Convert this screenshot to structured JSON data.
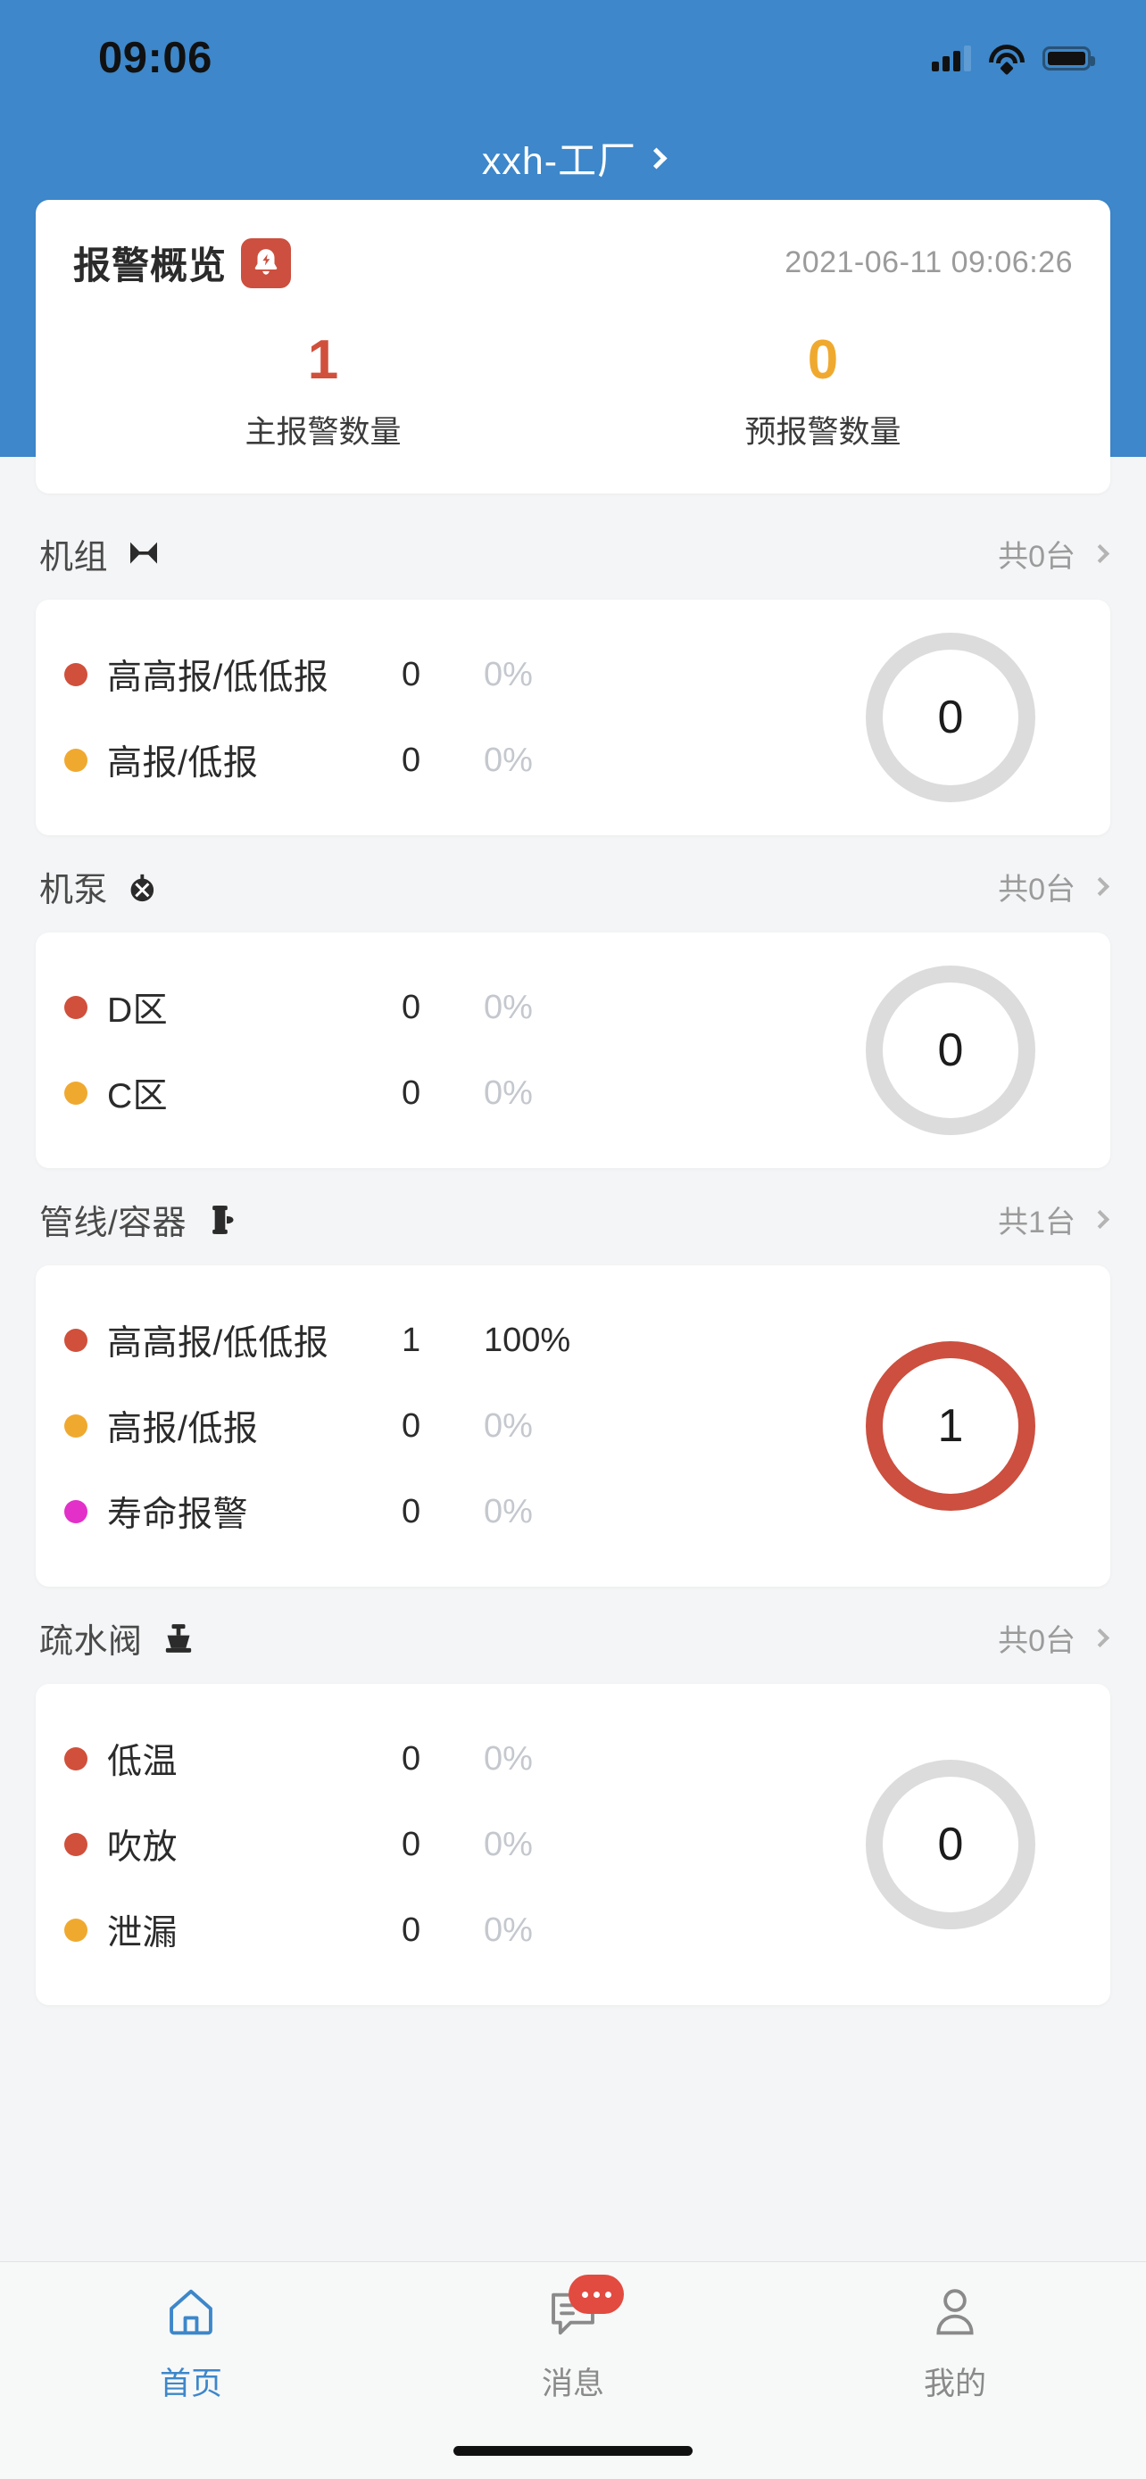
{
  "statusbar": {
    "time": "09:06",
    "cellular_icon": "cellular-signal-icon",
    "wifi_icon": "wifi-icon",
    "battery_icon": "battery-full-icon"
  },
  "header": {
    "title": "xxh-工厂",
    "chevron_icon": "chevron-right-icon",
    "background_color": "#3D87CA"
  },
  "overview": {
    "title": "报警概览",
    "badge_icon": "alarm-bell-icon",
    "badge_color": "#CC4F3F",
    "timestamp": "2021-06-11 09:06:26",
    "stats": [
      {
        "value": "1",
        "label": "主报警数量",
        "color": "#D0503C"
      },
      {
        "value": "0",
        "label": "预报警数量",
        "color": "#F0A92F"
      }
    ]
  },
  "sections": [
    {
      "name": "机组",
      "icon": "turbine-icon",
      "count_text": "共0台",
      "chevron_icon": "chevron-right-icon",
      "total": "0",
      "ring_color": "#DCDCDC",
      "rows": [
        {
          "label": "高高报/低低报",
          "value": "0",
          "percent": "0%",
          "dot_color": "#D0503C",
          "dot_class": "red",
          "pct_active": false
        },
        {
          "label": "高报/低报",
          "value": "0",
          "percent": "0%",
          "dot_color": "#F0A92F",
          "dot_class": "orange",
          "pct_active": false
        }
      ]
    },
    {
      "name": "机泵",
      "icon": "pump-icon",
      "count_text": "共0台",
      "chevron_icon": "chevron-right-icon",
      "total": "0",
      "ring_color": "#DCDCDC",
      "rows": [
        {
          "label": "D区",
          "value": "0",
          "percent": "0%",
          "dot_color": "#D0503C",
          "dot_class": "red",
          "pct_active": false
        },
        {
          "label": "C区",
          "value": "0",
          "percent": "0%",
          "dot_color": "#F0A92F",
          "dot_class": "orange",
          "pct_active": false
        }
      ]
    },
    {
      "name": "管线/容器",
      "icon": "pipeline-valve-icon",
      "count_text": "共1台",
      "chevron_icon": "chevron-right-icon",
      "total": "1",
      "ring_color": "#CC4F3F",
      "rows": [
        {
          "label": "高高报/低低报",
          "value": "1",
          "percent": "100%",
          "dot_color": "#D0503C",
          "dot_class": "red",
          "pct_active": true
        },
        {
          "label": "高报/低报",
          "value": "0",
          "percent": "0%",
          "dot_color": "#F0A92F",
          "dot_class": "orange",
          "pct_active": false
        },
        {
          "label": "寿命报警",
          "value": "0",
          "percent": "0%",
          "dot_color": "#E330C9",
          "dot_class": "magenta",
          "pct_active": false
        }
      ]
    },
    {
      "name": "疏水阀",
      "icon": "steam-trap-valve-icon",
      "count_text": "共0台",
      "chevron_icon": "chevron-right-icon",
      "total": "0",
      "ring_color": "#DCDCDC",
      "rows": [
        {
          "label": "低温",
          "value": "0",
          "percent": "0%",
          "dot_color": "#D0503C",
          "dot_class": "red",
          "pct_active": false
        },
        {
          "label": "吹放",
          "value": "0",
          "percent": "0%",
          "dot_color": "#D0503C",
          "dot_class": "red",
          "pct_active": false
        },
        {
          "label": "泄漏",
          "value": "0",
          "percent": "0%",
          "dot_color": "#F0A92F",
          "dot_class": "orange",
          "pct_active": false
        }
      ]
    }
  ],
  "tabbar": {
    "active_color": "#3D87CA",
    "inactive_color": "#8A8A8A",
    "items": [
      {
        "label": "首页",
        "icon": "home-icon",
        "active": true
      },
      {
        "label": "消息",
        "icon": "message-icon",
        "active": false,
        "badge_icon": "ellipsis-badge"
      },
      {
        "label": "我的",
        "icon": "person-icon",
        "active": false
      }
    ]
  }
}
